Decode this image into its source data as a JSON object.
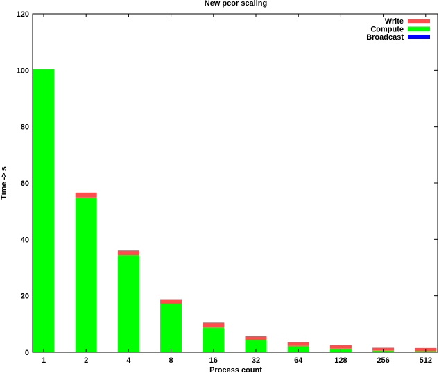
{
  "chart_data": {
    "type": "bar",
    "stacked": true,
    "title": "New pcor scaling",
    "xlabel": "Process count",
    "ylabel": "Time -> s",
    "ylim": [
      0,
      120
    ],
    "yticks": [
      0,
      20,
      40,
      60,
      80,
      100,
      120
    ],
    "categories": [
      "1",
      "2",
      "4",
      "8",
      "16",
      "32",
      "64",
      "128",
      "256",
      "512"
    ],
    "series": [
      {
        "name": "Broadcast",
        "color": "#0000ff",
        "values": [
          0,
          0,
          0,
          0,
          0,
          0,
          0,
          0,
          0,
          0
        ]
      },
      {
        "name": "Compute",
        "color": "#00ff00",
        "values": [
          100.5,
          54.9,
          34.4,
          17.2,
          8.8,
          4.4,
          2.3,
          1.3,
          0.7,
          0.4
        ]
      },
      {
        "name": "Write",
        "color": "#ff4d4d",
        "values": [
          0,
          1.7,
          1.7,
          1.6,
          1.7,
          1.3,
          1.3,
          1.2,
          0.9,
          1.1
        ]
      }
    ],
    "legend_order": [
      "Write",
      "Compute",
      "Broadcast"
    ],
    "legend_position": "top-right",
    "grid": false
  }
}
